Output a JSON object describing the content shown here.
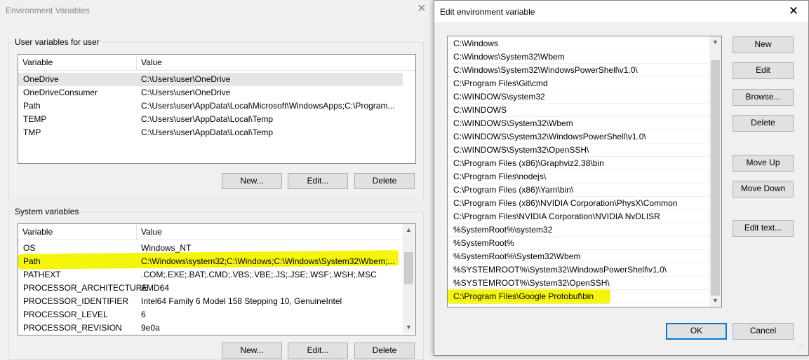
{
  "env_dialog": {
    "title": "Environment Variables",
    "user_section": {
      "label": "User variables for user",
      "headers": {
        "variable": "Variable",
        "value": "Value"
      },
      "rows": [
        {
          "variable": "OneDrive",
          "value": "C:\\Users\\user\\OneDrive"
        },
        {
          "variable": "OneDriveConsumer",
          "value": "C:\\Users\\user\\OneDrive"
        },
        {
          "variable": "Path",
          "value": "C:\\Users\\user\\AppData\\Local\\Microsoft\\WindowsApps;C:\\Program..."
        },
        {
          "variable": "TEMP",
          "value": "C:\\Users\\user\\AppData\\Local\\Temp"
        },
        {
          "variable": "TMP",
          "value": "C:\\Users\\user\\AppData\\Local\\Temp"
        }
      ],
      "buttons": {
        "new": "New...",
        "edit": "Edit...",
        "delete": "Delete"
      }
    },
    "system_section": {
      "label": "System variables",
      "headers": {
        "variable": "Variable",
        "value": "Value"
      },
      "rows": [
        {
          "variable": "OS",
          "value": "Windows_NT"
        },
        {
          "variable": "Path",
          "value": "C:\\Windows\\system32;C:\\Windows;C:\\Windows\\System32\\Wbem;..."
        },
        {
          "variable": "PATHEXT",
          "value": ".COM;.EXE;.BAT;.CMD;.VBS;.VBE;.JS;.JSE;.WSF;.WSH;.MSC"
        },
        {
          "variable": "PROCESSOR_ARCHITECTURE",
          "value": "AMD64"
        },
        {
          "variable": "PROCESSOR_IDENTIFIER",
          "value": "Intel64 Family 6 Model 158 Stepping 10, GenuineIntel"
        },
        {
          "variable": "PROCESSOR_LEVEL",
          "value": "6"
        },
        {
          "variable": "PROCESSOR_REVISION",
          "value": "9e0a"
        }
      ],
      "buttons": {
        "new": "New...",
        "edit": "Edit...",
        "delete": "Delete"
      }
    }
  },
  "edit_dialog": {
    "title": "Edit environment variable",
    "paths": [
      "C:\\Windows",
      "C:\\Windows\\System32\\Wbem",
      "C:\\Windows\\System32\\WindowsPowerShell\\v1.0\\",
      "C:\\Program Files\\Git\\cmd",
      "C:\\WINDOWS\\system32",
      "C:\\WINDOWS",
      "C:\\WINDOWS\\System32\\Wbem",
      "C:\\WINDOWS\\System32\\WindowsPowerShell\\v1.0\\",
      "C:\\WINDOWS\\System32\\OpenSSH\\",
      "C:\\Program Files (x86)\\Graphviz2.38\\bin",
      "C:\\Program Files\\nodejs\\",
      "C:\\Program Files (x86)\\Yarn\\bin\\",
      "C:\\Program Files (x86)\\NVIDIA Corporation\\PhysX\\Common",
      "C:\\Program Files\\NVIDIA Corporation\\NVIDIA NvDLISR",
      "%SystemRoot%\\system32",
      "%SystemRoot%",
      "%SystemRoot%\\System32\\Wbem",
      "%SYSTEMROOT%\\System32\\WindowsPowerShell\\v1.0\\",
      "%SYSTEMROOT%\\System32\\OpenSSH\\",
      "C:\\Program Files\\Google Protobuf\\bin"
    ],
    "highlighted_path": "C:\\Program Files\\Google Protobuf\\bin",
    "buttons": {
      "new": "New",
      "edit": "Edit",
      "browse": "Browse...",
      "delete": "Delete",
      "move_up": "Move Up",
      "move_down": "Move Down",
      "edit_text": "Edit text...",
      "ok": "OK",
      "cancel": "Cancel"
    }
  },
  "colors": {
    "highlight": "#f5f50c",
    "accent": "#0078d7",
    "selection": "#e5e5e5"
  },
  "icons": {
    "close": "close-icon",
    "scroll_up": "chevron-up-icon",
    "scroll_down": "chevron-down-icon",
    "resize": "resize-grip-icon"
  }
}
